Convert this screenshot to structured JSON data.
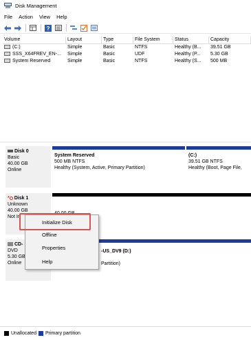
{
  "window": {
    "title": "Disk Management",
    "icon": "disk-management-icon"
  },
  "menu": [
    "File",
    "Action",
    "View",
    "Help"
  ],
  "toolbar": {
    "icons": [
      "back-icon",
      "forward-icon",
      "view-icon",
      "help-icon",
      "list-icon",
      "refresh-icon",
      "properties-icon",
      "disk-icon"
    ]
  },
  "volumes": {
    "headers": [
      "Volume",
      "Layout",
      "Type",
      "File System",
      "Status",
      "Capacity"
    ],
    "rows": [
      [
        "(C:)",
        "Simple",
        "Basic",
        "NTFS",
        "Healthy (B...",
        "39.51 GB"
      ],
      [
        "SSS_X64FREV_EN-...",
        "Simple",
        "Basic",
        "UDF",
        "Healthy (P...",
        "5.30 GB"
      ],
      [
        "System Reserved",
        "Simple",
        "Basic",
        "NTFS",
        "Healthy (S...",
        "500 MB"
      ]
    ]
  },
  "disks": {
    "disk0": {
      "name": "Disk 0",
      "type": "Basic",
      "size": "40.00 GB",
      "status": "Online",
      "part1": {
        "name": "System Reserved",
        "size": "500 MB NTFS",
        "status": "Healthy (System, Active, Primary Partition)"
      },
      "part2": {
        "name": "(C:)",
        "size": "39.51 GB NTFS",
        "status": "Healthy (Boot, Page File,"
      }
    },
    "disk1": {
      "name": "Disk 1",
      "type": "Unknown",
      "size": "40.00 GB",
      "status": "Not In",
      "part1": {
        "size": "40.00 GB"
      }
    },
    "cd": {
      "name": "CD-",
      "type": "DVD",
      "size": "5.30 GB",
      "status": "Online",
      "part1": {
        "name": "-US_DV9  (D:)",
        "status": "Partition)"
      }
    }
  },
  "context_menu": [
    "Initialize Disk",
    "Offline",
    "Properties",
    "Help"
  ],
  "legend": {
    "unallocated": "Unallocated",
    "primary": "Primary partition"
  },
  "colors": {
    "primary": "#1e3c9a",
    "unallocated": "#000000",
    "highlight": "#d9534f",
    "disk_error": "#d32f2f"
  }
}
